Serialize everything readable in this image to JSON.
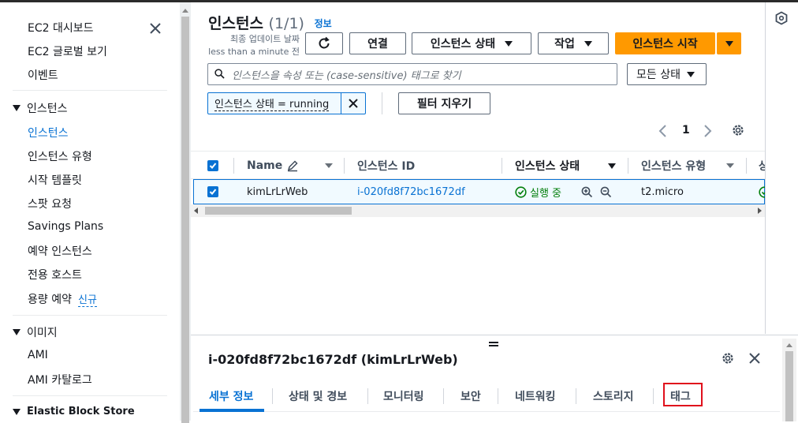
{
  "sidebar": {
    "items_top": [
      "EC2 대시보드",
      "EC2 글로벌 보기",
      "이벤트"
    ],
    "section_instances": "인스턴스",
    "instances_items": [
      "인스턴스",
      "인스턴스 유형",
      "시작 템플릿",
      "스팟 요청",
      "Savings Plans",
      "예약 인스턴스",
      "전용 호스트",
      "용량 예약"
    ],
    "new_badge": "신규",
    "section_images": "이미지",
    "images_items": [
      "AMI",
      "AMI 카탈로그"
    ],
    "section_ebs": "Elastic Block Store"
  },
  "header": {
    "title": "인스턴스",
    "count": "(1/1)",
    "info": "정보",
    "updated_line1": "최종 업데이트 날짜",
    "updated_line2": "less than a minute 전"
  },
  "toolbar": {
    "connect": "연결",
    "instance_state": "인스턴스 상태",
    "actions": "작업",
    "launch": "인스턴스 시작"
  },
  "search": {
    "placeholder": "인스턴스을 속성 또는 (case-sensitive) 태그로 찾기",
    "state_filter": "모든 상태"
  },
  "filter": {
    "token": "인스턴스 상태 = running",
    "clear": "필터 지우기"
  },
  "pagination": {
    "page": "1"
  },
  "table": {
    "headers": {
      "name": "Name",
      "id": "인스턴스 ID",
      "state": "인스턴스 상태",
      "type": "인스턴스 유형",
      "cut": "상"
    },
    "rows": [
      {
        "name": "kimLrLrWeb",
        "id": "i-020fd8f72bc1672df",
        "state": "실행 중",
        "type": "t2.micro"
      }
    ]
  },
  "split_panel": {
    "title": "i-020fd8f72bc1672df (kimLrLrWeb)",
    "tabs": [
      "세부 정보",
      "상태 및 경보",
      "모니터링",
      "보안",
      "네트워킹",
      "스토리지",
      "태그"
    ]
  },
  "colors": {
    "accent": "#0972d3",
    "primary": "#ff9900",
    "success": "#037f0c",
    "highlight": "#e0101c"
  }
}
